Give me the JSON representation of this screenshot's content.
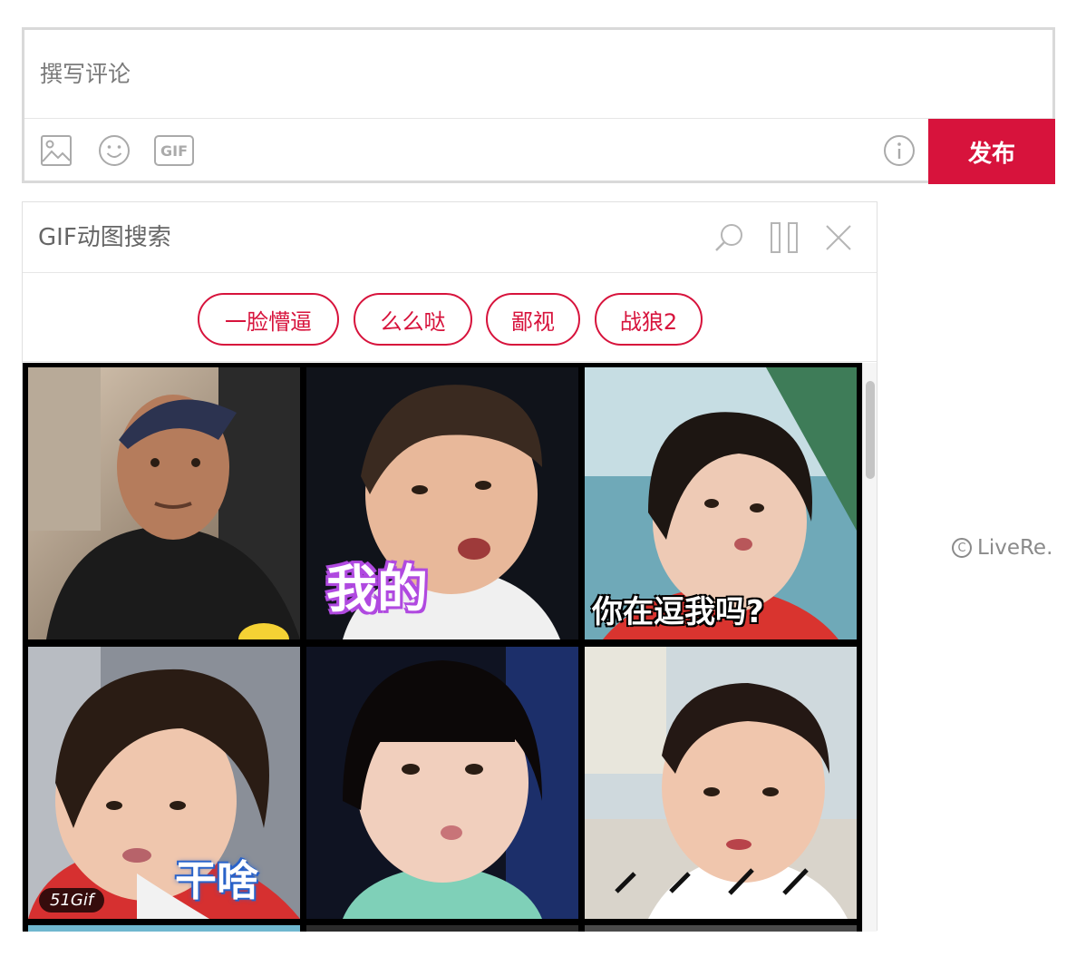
{
  "composer": {
    "placeholder": "撰写评论",
    "tools": [
      "image-icon",
      "emoji-icon",
      "gif-icon"
    ],
    "gif_label": "GIF",
    "info_icon": "info-icon",
    "submit_label": "发布"
  },
  "gif_panel": {
    "title": "GIF动图搜索",
    "actions": [
      "search-icon",
      "pause-icon",
      "close-icon"
    ],
    "tags": [
      "一脸懵逼",
      "么么哒",
      "鄙视",
      "战狼2"
    ],
    "items": [
      {
        "caption": ""
      },
      {
        "caption": "我的"
      },
      {
        "caption": "你在逗我吗?"
      },
      {
        "caption": "干啥",
        "watermark": "51Gif"
      },
      {
        "caption": ""
      },
      {
        "caption": ""
      }
    ]
  },
  "brand": {
    "name": "LiveRe.",
    "symbol": "C"
  },
  "colors": {
    "accent": "#d7133c",
    "border": "#d9d9d9",
    "muted": "#8a8a8a"
  }
}
